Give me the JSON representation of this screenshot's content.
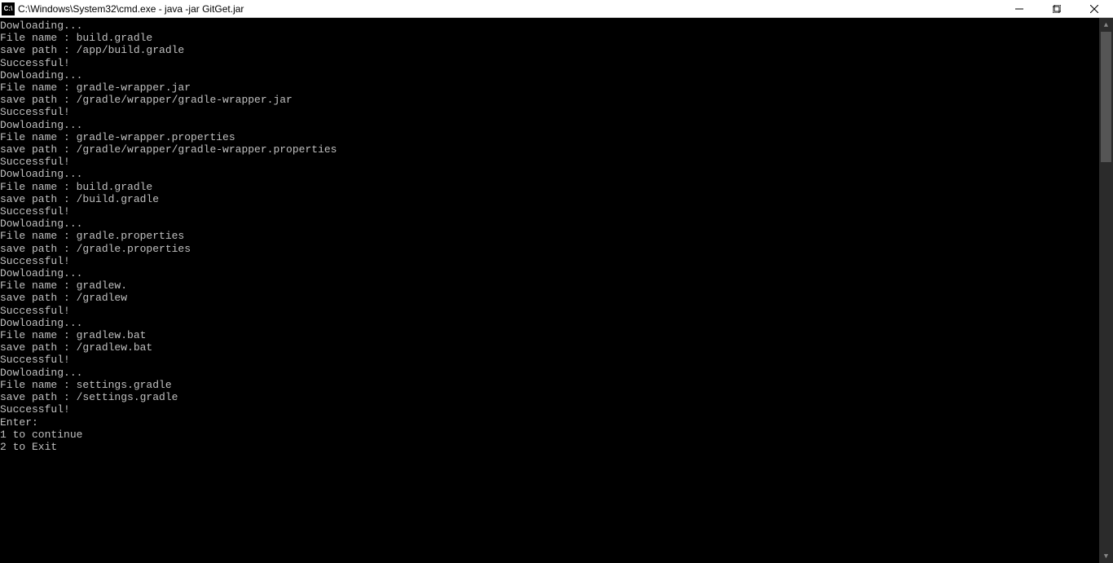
{
  "window": {
    "title": "C:\\Windows\\System32\\cmd.exe - java  -jar GitGet.jar",
    "icon_label": "cmd-icon"
  },
  "downloads": [
    {
      "downloading": "Dowloading...",
      "file_label": "File name : ",
      "file": "build.gradle",
      "path_label": "save path : ",
      "path": "/app/build.gradle",
      "status": "Successful!"
    },
    {
      "downloading": "Dowloading...",
      "file_label": "File name : ",
      "file": "gradle-wrapper.jar",
      "path_label": "save path : ",
      "path": "/gradle/wrapper/gradle-wrapper.jar",
      "status": "Successful!"
    },
    {
      "downloading": "Dowloading...",
      "file_label": "File name : ",
      "file": "gradle-wrapper.properties",
      "path_label": "save path : ",
      "path": "/gradle/wrapper/gradle-wrapper.properties",
      "status": "Successful!"
    },
    {
      "downloading": "Dowloading...",
      "file_label": "File name : ",
      "file": "build.gradle",
      "path_label": "save path : ",
      "path": "/build.gradle",
      "status": "Successful!"
    },
    {
      "downloading": "Dowloading...",
      "file_label": "File name : ",
      "file": "gradle.properties",
      "path_label": "save path : ",
      "path": "/gradle.properties",
      "status": "Successful!"
    },
    {
      "downloading": "Dowloading...",
      "file_label": "File name : ",
      "file": "gradlew.",
      "path_label": "save path : ",
      "path": "/gradlew",
      "status": "Successful!"
    },
    {
      "downloading": "Dowloading...",
      "file_label": "File name : ",
      "file": "gradlew.bat",
      "path_label": "save path : ",
      "path": "/gradlew.bat",
      "status": "Successful!"
    },
    {
      "downloading": "Dowloading...",
      "file_label": "File name : ",
      "file": "settings.gradle",
      "path_label": "save path : ",
      "path": "/settings.gradle",
      "status": "Successful!"
    }
  ],
  "prompt": {
    "enter": "Enter:",
    "opt1": "1 to continue",
    "opt2": "2 to Exit"
  }
}
